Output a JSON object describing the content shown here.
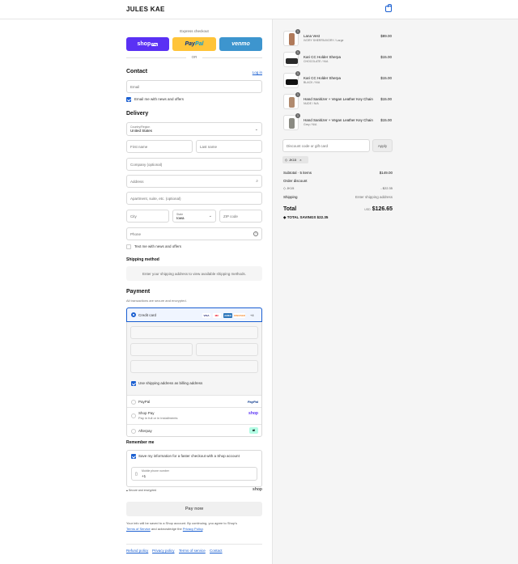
{
  "header": {
    "brand": "JULES KAE",
    "bag_icon": "shopping-bag-icon"
  },
  "express": {
    "label": "Express checkout",
    "shop_pay": {
      "word": "shop",
      "tag": "Pay"
    },
    "paypal": {
      "pay": "Pay",
      "pal": "Pal"
    },
    "venmo": "venmo",
    "or": "OR"
  },
  "contact": {
    "title": "Contact",
    "login": "Log in",
    "email_placeholder": "Email",
    "news": "Email me with news and offers"
  },
  "delivery": {
    "title": "Delivery",
    "country_label": "Country/Region",
    "country_value": "United States",
    "first_name": "First name",
    "last_name": "Last name",
    "company": "Company (optional)",
    "address": "Address",
    "apartment": "Apartment, suite, etc. (optional)",
    "city": "City",
    "state_label": "State",
    "state_value": "Iowa",
    "zip": "ZIP code",
    "phone": "Phone",
    "text_me": "Text me with news and offers"
  },
  "shipping": {
    "title": "Shipping method",
    "message": "Enter your shipping address to view available shipping methods."
  },
  "payment": {
    "title": "Payment",
    "secure": "All transactions are secure and encrypted.",
    "credit_card": "Credit card",
    "card_logos": [
      "VISA",
      "MC",
      "AMEX",
      "DISCOVER"
    ],
    "more_cards": "+4",
    "billing_same": "Use shipping address as billing address",
    "paypal": "PayPal",
    "paypal_logo": "PayPal",
    "shop_pay": "Shop Pay",
    "shop_pay_sub": "Pay in full or in installments",
    "shop_logo": "shop",
    "afterpay": "Afterpay"
  },
  "remember": {
    "title": "Remember me",
    "save": "Save my information for a faster checkout with a Shop account",
    "phone_label": "Mobile phone number",
    "phone_value": "+1",
    "secure": "Secure and encrypted",
    "shop_logo": "shop"
  },
  "pay_now": "Pay now",
  "legal": {
    "text1": "Your info will be saved to a Shop account. By continuing, you agree to Shop's",
    "tos": "Terms of Service",
    "and": " and acknowledge the ",
    "privacy": "Privacy Policy",
    "end": "."
  },
  "footer": [
    "Refund policy",
    "Privacy policy",
    "Terms of service",
    "Contact"
  ],
  "summary": {
    "items": [
      {
        "name": "Lana Vest",
        "variant": "IVORY SHERPA/IVORY / Large",
        "price": "$89.00",
        "qty": "1",
        "color": "#b07a5a"
      },
      {
        "name": "Kari CC Holder Sherpa",
        "variant": "CHOCOLATE / N/A",
        "price": "$15.00",
        "qty": "1",
        "color": "#2a2a2a"
      },
      {
        "name": "Kari CC Holder Sherpa",
        "variant": "BLACK / N/A",
        "price": "$15.00",
        "qty": "1",
        "color": "#111111"
      },
      {
        "name": "Hand Sanitizer + Vegan Leather Key Chain",
        "variant": "NUDE / N/A",
        "price": "$15.00",
        "qty": "1",
        "color": "#b08a6e"
      },
      {
        "name": "Hand Sanitizer + Vegan Leather Key Chain",
        "variant": "Grey / N/A",
        "price": "$15.00",
        "qty": "1",
        "color": "#8a8a82"
      }
    ],
    "discount_placeholder": "Discount code or gift card",
    "apply": "Apply",
    "code_tag": "JK15",
    "subtotal_label": "Subtotal · 5 items",
    "subtotal": "$149.00",
    "order_discount": "Order discount",
    "discount_code": "JK15",
    "discount_amount": "- $22.35",
    "shipping_label": "Shipping",
    "shipping_value": "Enter shipping address",
    "total_label": "Total",
    "currency": "USD",
    "total": "$126.65",
    "savings_label": "TOTAL SAVINGS",
    "savings": "$22.35"
  }
}
